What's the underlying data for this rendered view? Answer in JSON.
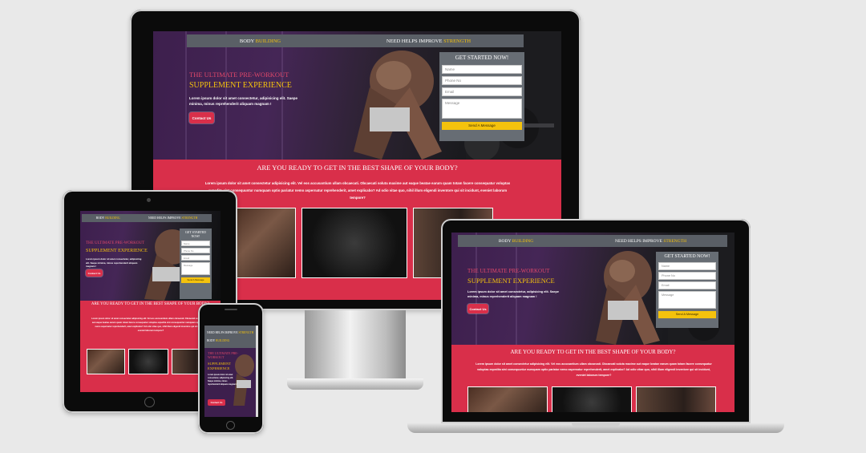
{
  "site": {
    "nav": {
      "brand_prefix": "BODY",
      "brand_highlight": "BUILDING",
      "tagline_prefix": "NEED HELPS IMPROVE",
      "tagline_highlight": "STRENGTH"
    },
    "hero": {
      "headline_line1": "THE ULTIMATE PRE-WORKOUT",
      "headline_line2": "SUPPLEMENT EXPERIENCE",
      "subtext": "Lorem ipsum dolor sit amet consectetur, adipisicing elit. Saepe minima, minus reprehenderit aliquam magnam !",
      "cta_label": "Contact Us"
    },
    "form": {
      "title": "GET STARTED NOW!",
      "name_placeholder": "Name",
      "phone_placeholder": "Phone No",
      "email_placeholder": "Email",
      "message_placeholder": "Message",
      "submit_label": "Send A Message"
    },
    "band": {
      "title": "ARE YOU READY TO GET IN THE BEST SHAPE OF YOUR BODY?",
      "text": "Lorem ipsum dolor sit amet consectetur adipisicing elit. Vel eos accusantium ullam obcaecati. Obcaecati soluta maxime aut eaque beatae earum quam totam facere consequatur voluptas expedita sint consequuntur numquam optio pariatur nemo aspernatur reprehenderit, amet explicabo? Ad odio vitae quo, nihil illum eligendi inventore qui sit incidunt, eveniet laborum tempore?",
      "text_short": "Lorem ipsum dolor sit amet consectetur adipisicing elit. Vel eos accusantium ullam obcaecati. Obcaecati soluta maxime aut eaque beatae earum quam totam facere consequatur voluptas expedita sint consequuntur numquam optio pariatur nemo aspernatur reprehenderit, amet explicabo? Ad odio vitae quo, nihil illum eligendi inventore qui sit incidunt, eveniet laborum tempore?"
    }
  },
  "colors": {
    "accent_red": "#d92f4a",
    "accent_yellow": "#f4c20d",
    "nav_gray": "#5a5f66",
    "headline_pink": "#e0486a"
  },
  "devices": [
    "desktop-monitor",
    "tablet",
    "laptop",
    "smartphone"
  ]
}
